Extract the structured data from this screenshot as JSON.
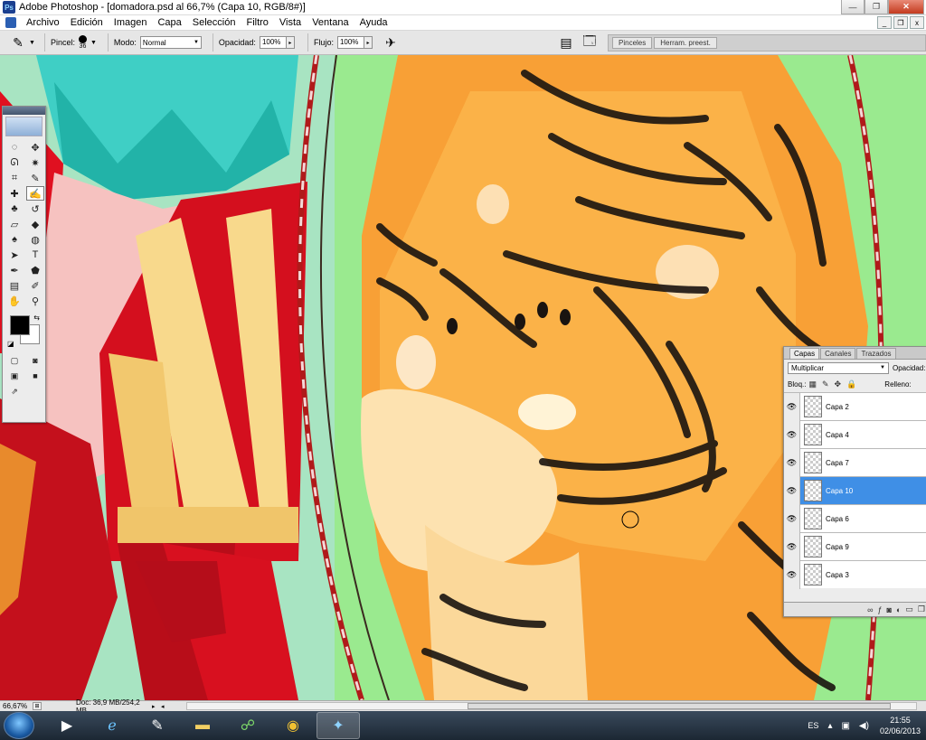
{
  "window": {
    "title": "Adobe Photoshop - [domadora.psd al 66,7% (Capa 10, RGB/8#)]",
    "controls": [
      "minimize",
      "restore",
      "close"
    ]
  },
  "menu": {
    "items": [
      "Archivo",
      "Edición",
      "Imagen",
      "Capa",
      "Selección",
      "Filtro",
      "Vista",
      "Ventana",
      "Ayuda"
    ]
  },
  "options": {
    "brush_label": "Pincel:",
    "brush_size": "36",
    "mode_label": "Modo:",
    "mode_value": "Normal",
    "opacity_label": "Opacidad:",
    "opacity_value": "100%",
    "flow_label": "Flujo:",
    "flow_value": "100%",
    "well_tabs": [
      "Pinceles",
      "Herram. preest."
    ]
  },
  "tools": {
    "items": [
      {
        "name": "marquee-tool",
        "glyph": "◌"
      },
      {
        "name": "move-tool",
        "glyph": "✥"
      },
      {
        "name": "lasso-tool",
        "glyph": "ᘏ"
      },
      {
        "name": "magic-wand-tool",
        "glyph": "✷"
      },
      {
        "name": "crop-tool",
        "glyph": "⌗"
      },
      {
        "name": "eyedropper-tool",
        "glyph": "✎"
      },
      {
        "name": "healing-tool",
        "glyph": "✚"
      },
      {
        "name": "brush-tool",
        "glyph": "✍"
      },
      {
        "name": "stamp-tool",
        "glyph": "♣"
      },
      {
        "name": "history-brush-tool",
        "glyph": "↺"
      },
      {
        "name": "eraser-tool",
        "glyph": "▱"
      },
      {
        "name": "bucket-tool",
        "glyph": "◆"
      },
      {
        "name": "blur-tool",
        "glyph": "♠"
      },
      {
        "name": "dodge-tool",
        "glyph": "◍"
      },
      {
        "name": "path-select-tool",
        "glyph": "➤"
      },
      {
        "name": "type-tool",
        "glyph": "T"
      },
      {
        "name": "pen-tool",
        "glyph": "✒"
      },
      {
        "name": "shape-tool",
        "glyph": "⬟"
      },
      {
        "name": "notes-tool",
        "glyph": "▤"
      },
      {
        "name": "color-sampler-tool",
        "glyph": "✐"
      },
      {
        "name": "hand-tool",
        "glyph": "✋"
      },
      {
        "name": "zoom-tool",
        "glyph": "⚲"
      }
    ]
  },
  "layers_panel": {
    "tabs": [
      "Capas",
      "Canales",
      "Trazados"
    ],
    "blend_mode": "Multiplicar",
    "opacity_label": "Opacidad:",
    "lock_label": "Bloq.:",
    "fill_label": "Relleno:",
    "layers": [
      {
        "name": "Capa 2",
        "selected": false
      },
      {
        "name": "Capa 4",
        "selected": false
      },
      {
        "name": "Capa 7",
        "selected": false
      },
      {
        "name": "Capa 10",
        "selected": true
      },
      {
        "name": "Capa 6",
        "selected": false
      },
      {
        "name": "Capa 9",
        "selected": false
      },
      {
        "name": "Capa 3",
        "selected": false
      }
    ]
  },
  "status": {
    "zoom": "66,67%",
    "doc": "Doc: 36,9 MB/254,2 MB"
  },
  "taskbar": {
    "apps": [
      "media-player-icon",
      "internet-explorer-icon",
      "paint-icon",
      "file-explorer-icon",
      "network-icon",
      "chrome-icon",
      "photoshop-icon"
    ],
    "lang": "ES",
    "time": "21:55",
    "date": "02/06/2013"
  },
  "colors": {
    "canvas_bg": "#9aea8f",
    "tiger": "#f7a23a",
    "selected_layer": "#3f8fe6",
    "taskbar": "#1c2733"
  }
}
